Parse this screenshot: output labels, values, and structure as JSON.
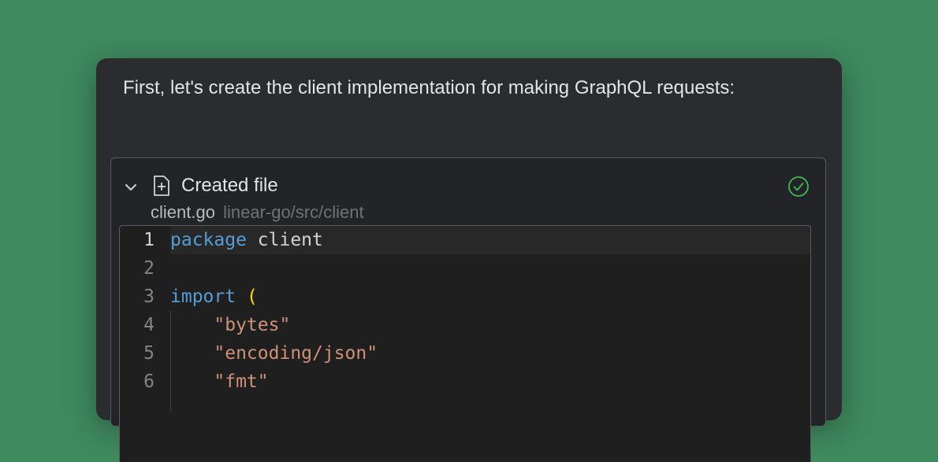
{
  "message": "First, let's create the client implementation for making GraphQL requests:",
  "file_card": {
    "title": "Created file",
    "file_name": "client.go",
    "file_path": "linear-go/src/client",
    "status_icon": "check-circle-icon"
  },
  "code_lines": [
    {
      "n": "1",
      "tokens": [
        {
          "t": "package",
          "c": "kw"
        },
        {
          "t": " client",
          "c": "id"
        }
      ]
    },
    {
      "n": "2",
      "tokens": []
    },
    {
      "n": "3",
      "tokens": [
        {
          "t": "import",
          "c": "kw"
        },
        {
          "t": " ",
          "c": "id"
        },
        {
          "t": "(",
          "c": "paren"
        }
      ]
    },
    {
      "n": "4",
      "tokens": [
        {
          "t": "    ",
          "c": "id"
        },
        {
          "t": "\"bytes\"",
          "c": "str"
        }
      ]
    },
    {
      "n": "5",
      "tokens": [
        {
          "t": "    ",
          "c": "id"
        },
        {
          "t": "\"encoding/json\"",
          "c": "str"
        }
      ]
    },
    {
      "n": "6",
      "tokens": [
        {
          "t": "    ",
          "c": "id"
        },
        {
          "t": "\"fmt\"",
          "c": "str"
        }
      ]
    }
  ],
  "colors": {
    "background": "#3f8a5f",
    "panel": "#2b2c30",
    "keyword": "#569cd6",
    "string": "#ce9178",
    "bracket": "#ffd700",
    "success": "#3fb950"
  }
}
